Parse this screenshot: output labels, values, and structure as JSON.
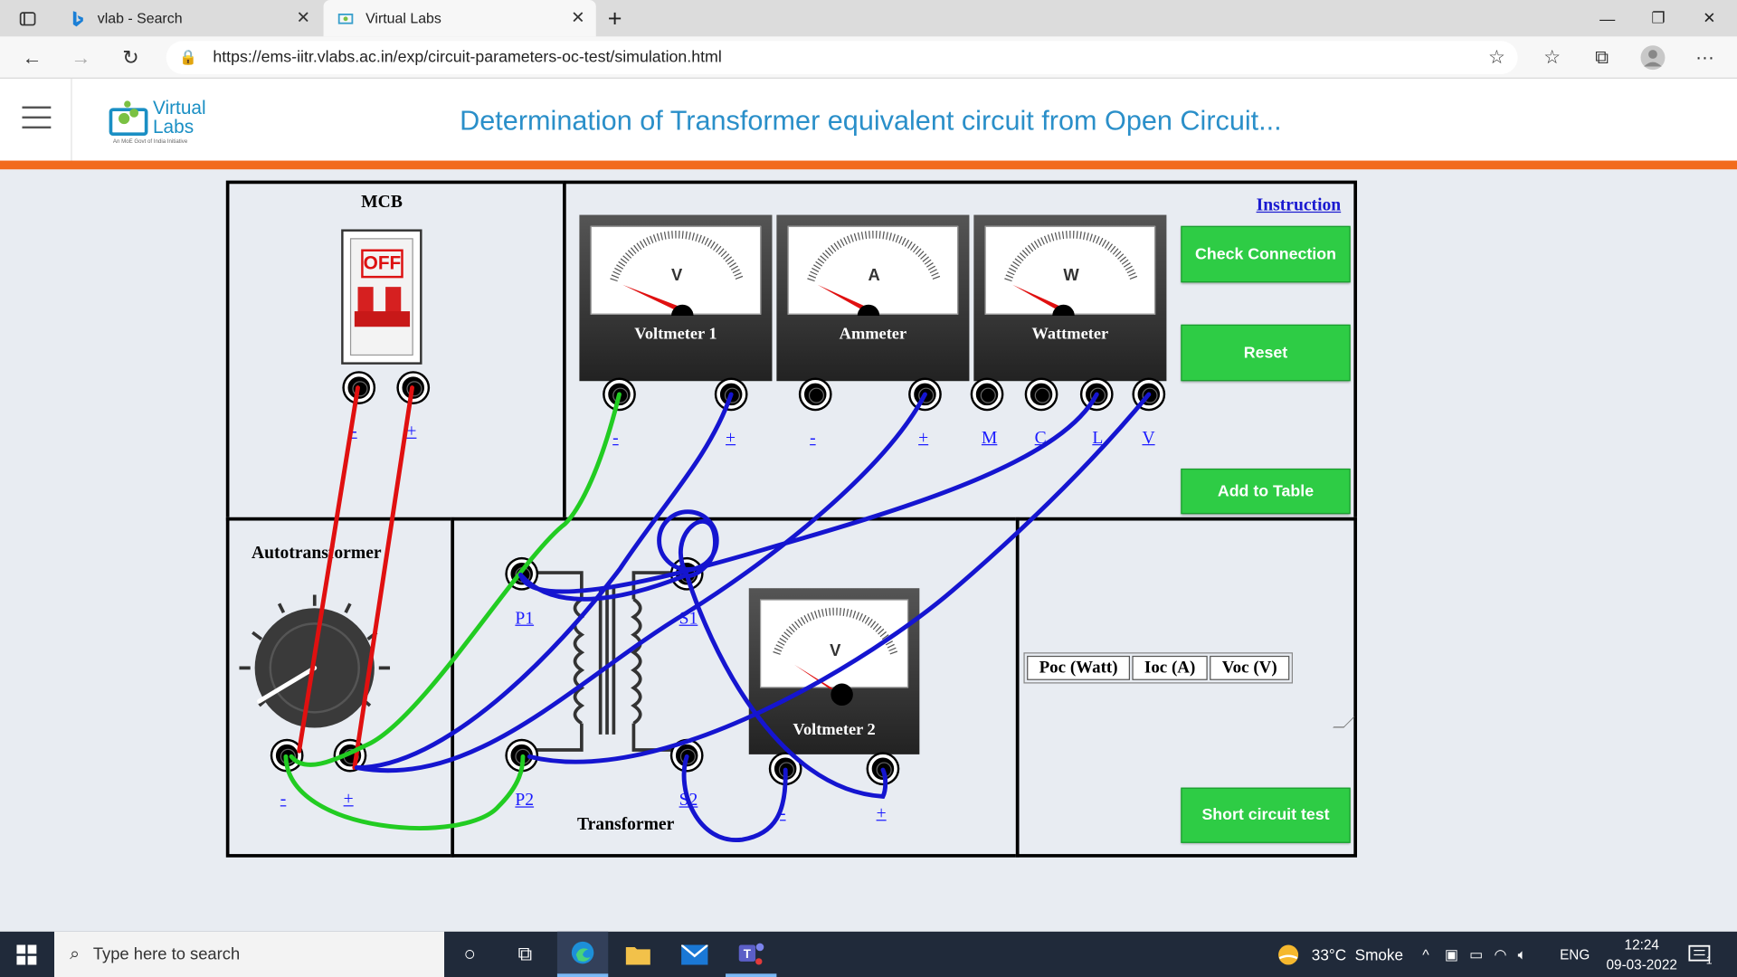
{
  "browser": {
    "tabs": [
      {
        "label": "vlab - Search",
        "icon": "bing-icon"
      },
      {
        "label": "Virtual Labs",
        "icon": "virtual-labs-icon"
      }
    ],
    "url": "https://ems-iitr.vlabs.ac.in/exp/circuit-parameters-oc-test/simulation.html"
  },
  "site": {
    "logo_line1": "Virtual",
    "logo_line2": "Labs",
    "logo_tag": "An MoE Govt of India Initiative",
    "title": "Determination of Transformer equivalent circuit from Open Circuit..."
  },
  "lab": {
    "mcb_title": "MCB",
    "mcb_state": "OFF",
    "mcb_labels": [
      "-",
      "+"
    ],
    "instruction": "Instruction",
    "meters": [
      {
        "symbol": "V",
        "label": "Voltmeter 1"
      },
      {
        "symbol": "A",
        "label": "Ammeter"
      },
      {
        "symbol": "W",
        "label": "Wattmeter"
      },
      {
        "symbol": "V",
        "label": "Voltmeter 2"
      }
    ],
    "v1_terms": [
      "-",
      "+"
    ],
    "amm_terms": [
      "-",
      "+"
    ],
    "watt_terms": [
      "M",
      "C",
      "L",
      "V"
    ],
    "buttons": {
      "check": "Check Connection",
      "reset": "Reset",
      "add": "Add to Table",
      "short": "Short circuit test"
    },
    "auto_title": "Autotransformer",
    "auto_terms": [
      "-",
      "+"
    ],
    "transformer_title": "Transformer",
    "xfmr_terms": [
      "P1",
      "S1",
      "P2",
      "S2"
    ],
    "v2_terms": [
      "-",
      "+"
    ],
    "table_headers": [
      "Poc (Watt)",
      "Ioc (A)",
      "Voc (V)"
    ]
  },
  "taskbar": {
    "search_placeholder": "Type here to search",
    "weather": "33°C  Smoke",
    "lang": "ENG",
    "time": "12:24",
    "date": "09-03-2022",
    "notif_count": "1"
  },
  "colors": {
    "accent_orange": "#f26b1d",
    "title_blue": "#2a8fc9",
    "button_green": "#2ecc45",
    "wire_red": "#e01010",
    "wire_green": "#22cc22",
    "wire_blue": "#1515d0"
  }
}
